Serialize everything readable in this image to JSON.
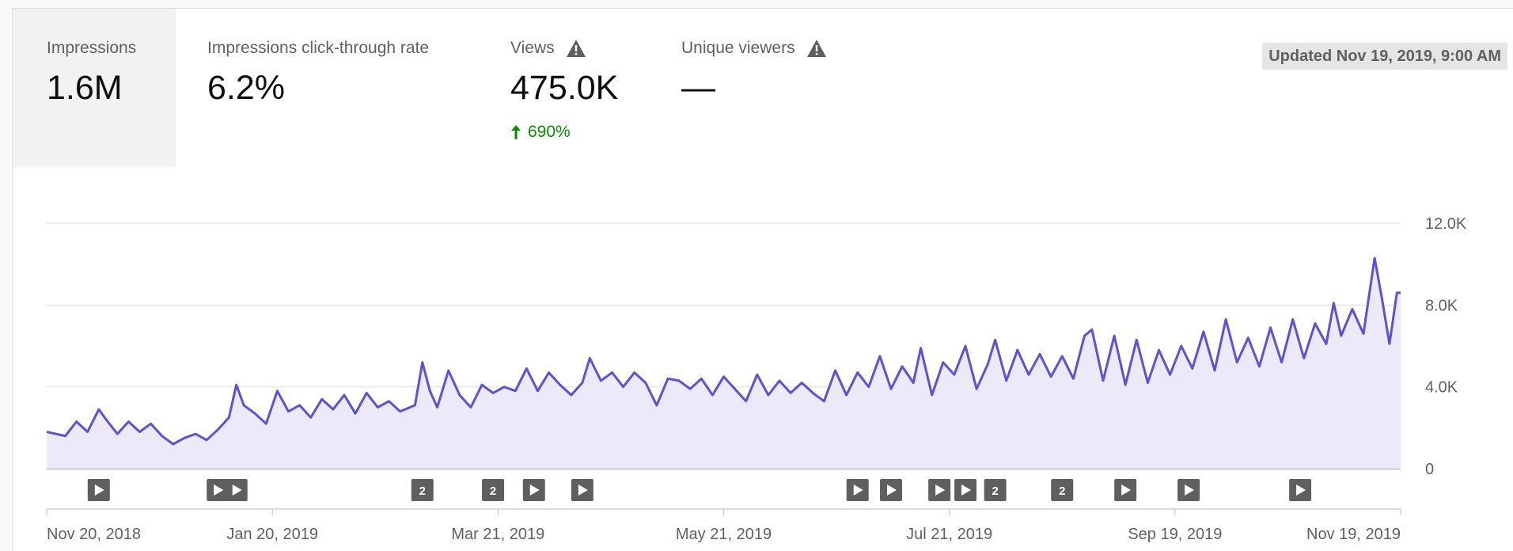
{
  "metrics": [
    {
      "label": "Impressions",
      "value": "1.6M"
    },
    {
      "label": "Impressions click-through rate",
      "value": "6.2%"
    },
    {
      "label": "Views",
      "value": "475.0K",
      "change": "690%"
    },
    {
      "label": "Unique viewers",
      "value": "—"
    }
  ],
  "updated": "Updated Nov 19, 2019, 9:00 AM",
  "colors": {
    "line": "#5b52d4",
    "area": "#eceaf9",
    "positive": "#0b8a00",
    "marker": "#5f5f5f"
  },
  "chart_data": {
    "type": "area",
    "title": "",
    "xlabel": "",
    "ylabel": "",
    "x_range": [
      "2018-11-20",
      "2019-11-19"
    ],
    "ylim": [
      0,
      12000
    ],
    "y_ticks": [
      "0",
      "4.0K",
      "8.0K",
      "12.0K"
    ],
    "x_ticks": [
      "Nov 20, 2018",
      "Jan 20, 2019",
      "Mar 21, 2019",
      "May 21, 2019",
      "Jul 21, 2019",
      "Sep 19, 2019",
      "Nov 19, 2019"
    ],
    "grid": true,
    "series": [
      {
        "name": "",
        "points": [
          [
            "2018-11-20",
            1800
          ],
          [
            "2018-11-25",
            1600
          ],
          [
            "2018-11-28",
            2300
          ],
          [
            "2018-12-01",
            1800
          ],
          [
            "2018-12-04",
            2900
          ],
          [
            "2018-12-06",
            2400
          ],
          [
            "2018-12-09",
            1700
          ],
          [
            "2018-12-12",
            2300
          ],
          [
            "2018-12-15",
            1800
          ],
          [
            "2018-12-18",
            2200
          ],
          [
            "2018-12-21",
            1600
          ],
          [
            "2018-12-24",
            1200
          ],
          [
            "2018-12-27",
            1500
          ],
          [
            "2018-12-30",
            1700
          ],
          [
            "2019-01-02",
            1400
          ],
          [
            "2019-01-05",
            1900
          ],
          [
            "2019-01-08",
            2500
          ],
          [
            "2019-01-10",
            4100
          ],
          [
            "2019-01-12",
            3100
          ],
          [
            "2019-01-15",
            2700
          ],
          [
            "2019-01-18",
            2200
          ],
          [
            "2019-01-21",
            3800
          ],
          [
            "2019-01-24",
            2800
          ],
          [
            "2019-01-27",
            3100
          ],
          [
            "2019-01-30",
            2500
          ],
          [
            "2019-02-02",
            3400
          ],
          [
            "2019-02-05",
            2900
          ],
          [
            "2019-02-08",
            3600
          ],
          [
            "2019-02-11",
            2700
          ],
          [
            "2019-02-14",
            3700
          ],
          [
            "2019-02-17",
            3000
          ],
          [
            "2019-02-20",
            3300
          ],
          [
            "2019-02-23",
            2800
          ],
          [
            "2019-02-27",
            3100
          ],
          [
            "2019-03-01",
            5200
          ],
          [
            "2019-03-03",
            3800
          ],
          [
            "2019-03-05",
            3000
          ],
          [
            "2019-03-08",
            4800
          ],
          [
            "2019-03-11",
            3600
          ],
          [
            "2019-03-14",
            3000
          ],
          [
            "2019-03-17",
            4100
          ],
          [
            "2019-03-20",
            3700
          ],
          [
            "2019-03-23",
            4000
          ],
          [
            "2019-03-26",
            3800
          ],
          [
            "2019-03-29",
            4900
          ],
          [
            "2019-04-01",
            3800
          ],
          [
            "2019-04-04",
            4700
          ],
          [
            "2019-04-07",
            4100
          ],
          [
            "2019-04-10",
            3600
          ],
          [
            "2019-04-13",
            4200
          ],
          [
            "2019-04-15",
            5400
          ],
          [
            "2019-04-18",
            4300
          ],
          [
            "2019-04-21",
            4700
          ],
          [
            "2019-04-24",
            4000
          ],
          [
            "2019-04-27",
            4700
          ],
          [
            "2019-04-30",
            4200
          ],
          [
            "2019-05-03",
            3100
          ],
          [
            "2019-05-06",
            4400
          ],
          [
            "2019-05-09",
            4300
          ],
          [
            "2019-05-12",
            3900
          ],
          [
            "2019-05-15",
            4400
          ],
          [
            "2019-05-18",
            3600
          ],
          [
            "2019-05-21",
            4500
          ],
          [
            "2019-05-24",
            3900
          ],
          [
            "2019-05-27",
            3300
          ],
          [
            "2019-05-30",
            4600
          ],
          [
            "2019-06-02",
            3600
          ],
          [
            "2019-06-05",
            4300
          ],
          [
            "2019-06-08",
            3700
          ],
          [
            "2019-06-11",
            4200
          ],
          [
            "2019-06-14",
            3700
          ],
          [
            "2019-06-17",
            3300
          ],
          [
            "2019-06-20",
            4800
          ],
          [
            "2019-06-23",
            3600
          ],
          [
            "2019-06-26",
            4700
          ],
          [
            "2019-06-29",
            4000
          ],
          [
            "2019-07-02",
            5500
          ],
          [
            "2019-07-05",
            3900
          ],
          [
            "2019-07-08",
            5000
          ],
          [
            "2019-07-11",
            4200
          ],
          [
            "2019-07-13",
            5900
          ],
          [
            "2019-07-16",
            3600
          ],
          [
            "2019-07-19",
            5200
          ],
          [
            "2019-07-22",
            4600
          ],
          [
            "2019-07-25",
            6000
          ],
          [
            "2019-07-28",
            3900
          ],
          [
            "2019-07-31",
            5100
          ],
          [
            "2019-08-02",
            6300
          ],
          [
            "2019-08-05",
            4300
          ],
          [
            "2019-08-08",
            5800
          ],
          [
            "2019-08-11",
            4600
          ],
          [
            "2019-08-14",
            5600
          ],
          [
            "2019-08-17",
            4500
          ],
          [
            "2019-08-20",
            5500
          ],
          [
            "2019-08-23",
            4400
          ],
          [
            "2019-08-26",
            6500
          ],
          [
            "2019-08-28",
            6800
          ],
          [
            "2019-08-31",
            4300
          ],
          [
            "2019-09-03",
            6500
          ],
          [
            "2019-09-06",
            4100
          ],
          [
            "2019-09-09",
            6300
          ],
          [
            "2019-09-12",
            4200
          ],
          [
            "2019-09-15",
            5800
          ],
          [
            "2019-09-18",
            4600
          ],
          [
            "2019-09-21",
            6000
          ],
          [
            "2019-09-24",
            4900
          ],
          [
            "2019-09-27",
            6700
          ],
          [
            "2019-09-30",
            4800
          ],
          [
            "2019-10-03",
            7300
          ],
          [
            "2019-10-06",
            5200
          ],
          [
            "2019-10-09",
            6400
          ],
          [
            "2019-10-12",
            5000
          ],
          [
            "2019-10-15",
            6900
          ],
          [
            "2019-10-18",
            5200
          ],
          [
            "2019-10-21",
            7300
          ],
          [
            "2019-10-24",
            5400
          ],
          [
            "2019-10-27",
            7100
          ],
          [
            "2019-10-30",
            6100
          ],
          [
            "2019-11-01",
            8100
          ],
          [
            "2019-11-03",
            6500
          ],
          [
            "2019-11-06",
            7800
          ],
          [
            "2019-11-09",
            6600
          ],
          [
            "2019-11-12",
            10300
          ],
          [
            "2019-11-14",
            8300
          ],
          [
            "2019-11-16",
            6100
          ],
          [
            "2019-11-18",
            8600
          ],
          [
            "2019-11-19",
            8600
          ]
        ]
      }
    ],
    "markers": [
      {
        "date": "2018-12-04",
        "kind": "video"
      },
      {
        "date": "2019-01-05",
        "kind": "video"
      },
      {
        "date": "2019-01-10",
        "kind": "video"
      },
      {
        "date": "2019-03-01",
        "kind": "count",
        "label": "2"
      },
      {
        "date": "2019-03-20",
        "kind": "count",
        "label": "2"
      },
      {
        "date": "2019-03-31",
        "kind": "video"
      },
      {
        "date": "2019-04-13",
        "kind": "video"
      },
      {
        "date": "2019-06-26",
        "kind": "video"
      },
      {
        "date": "2019-07-05",
        "kind": "video"
      },
      {
        "date": "2019-07-18",
        "kind": "video"
      },
      {
        "date": "2019-07-25",
        "kind": "video"
      },
      {
        "date": "2019-08-02",
        "kind": "count",
        "label": "2"
      },
      {
        "date": "2019-08-20",
        "kind": "count",
        "label": "2"
      },
      {
        "date": "2019-09-06",
        "kind": "video"
      },
      {
        "date": "2019-09-23",
        "kind": "video"
      },
      {
        "date": "2019-10-23",
        "kind": "video"
      }
    ]
  }
}
